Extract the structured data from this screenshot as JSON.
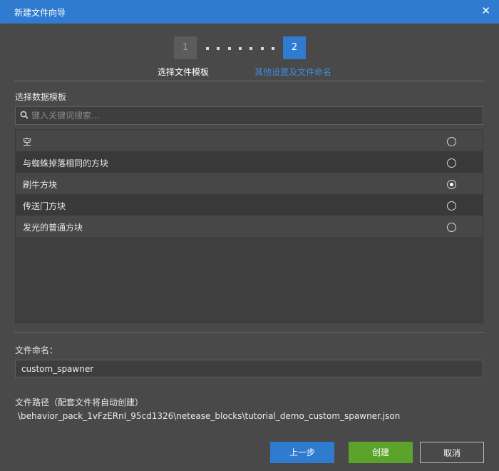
{
  "window": {
    "title": "新建文件向导",
    "close_glyph": "✕"
  },
  "steps": [
    {
      "number": "1",
      "label": "选择文件模板",
      "state": "done"
    },
    {
      "number": "2",
      "label": "其他设置及文件命名",
      "state": "active"
    }
  ],
  "template_section": {
    "heading": "选择数据模板",
    "search_placeholder": "键入关键词搜索...",
    "search_icon": "search-icon",
    "items": [
      {
        "label": "空",
        "selected": false
      },
      {
        "label": "与蜘蛛掉落相同的方块",
        "selected": false
      },
      {
        "label": "刷牛方块",
        "selected": true
      },
      {
        "label": "传送门方块",
        "selected": false
      },
      {
        "label": "发光的普通方块",
        "selected": false
      }
    ]
  },
  "file_name": {
    "label": "文件命名：",
    "value": "custom_spawner"
  },
  "file_path": {
    "label": "文件路径（配套文件将自动创建）",
    "value": "\\behavior_pack_1vFzERnI_95cd1326\\netease_blocks\\tutorial_demo_custom_spawner.json"
  },
  "buttons": {
    "prev": "上一步",
    "create": "创建",
    "cancel": "取消"
  },
  "colors": {
    "accent": "#2f7bd0",
    "create": "#5ba32b",
    "background": "#494949"
  }
}
